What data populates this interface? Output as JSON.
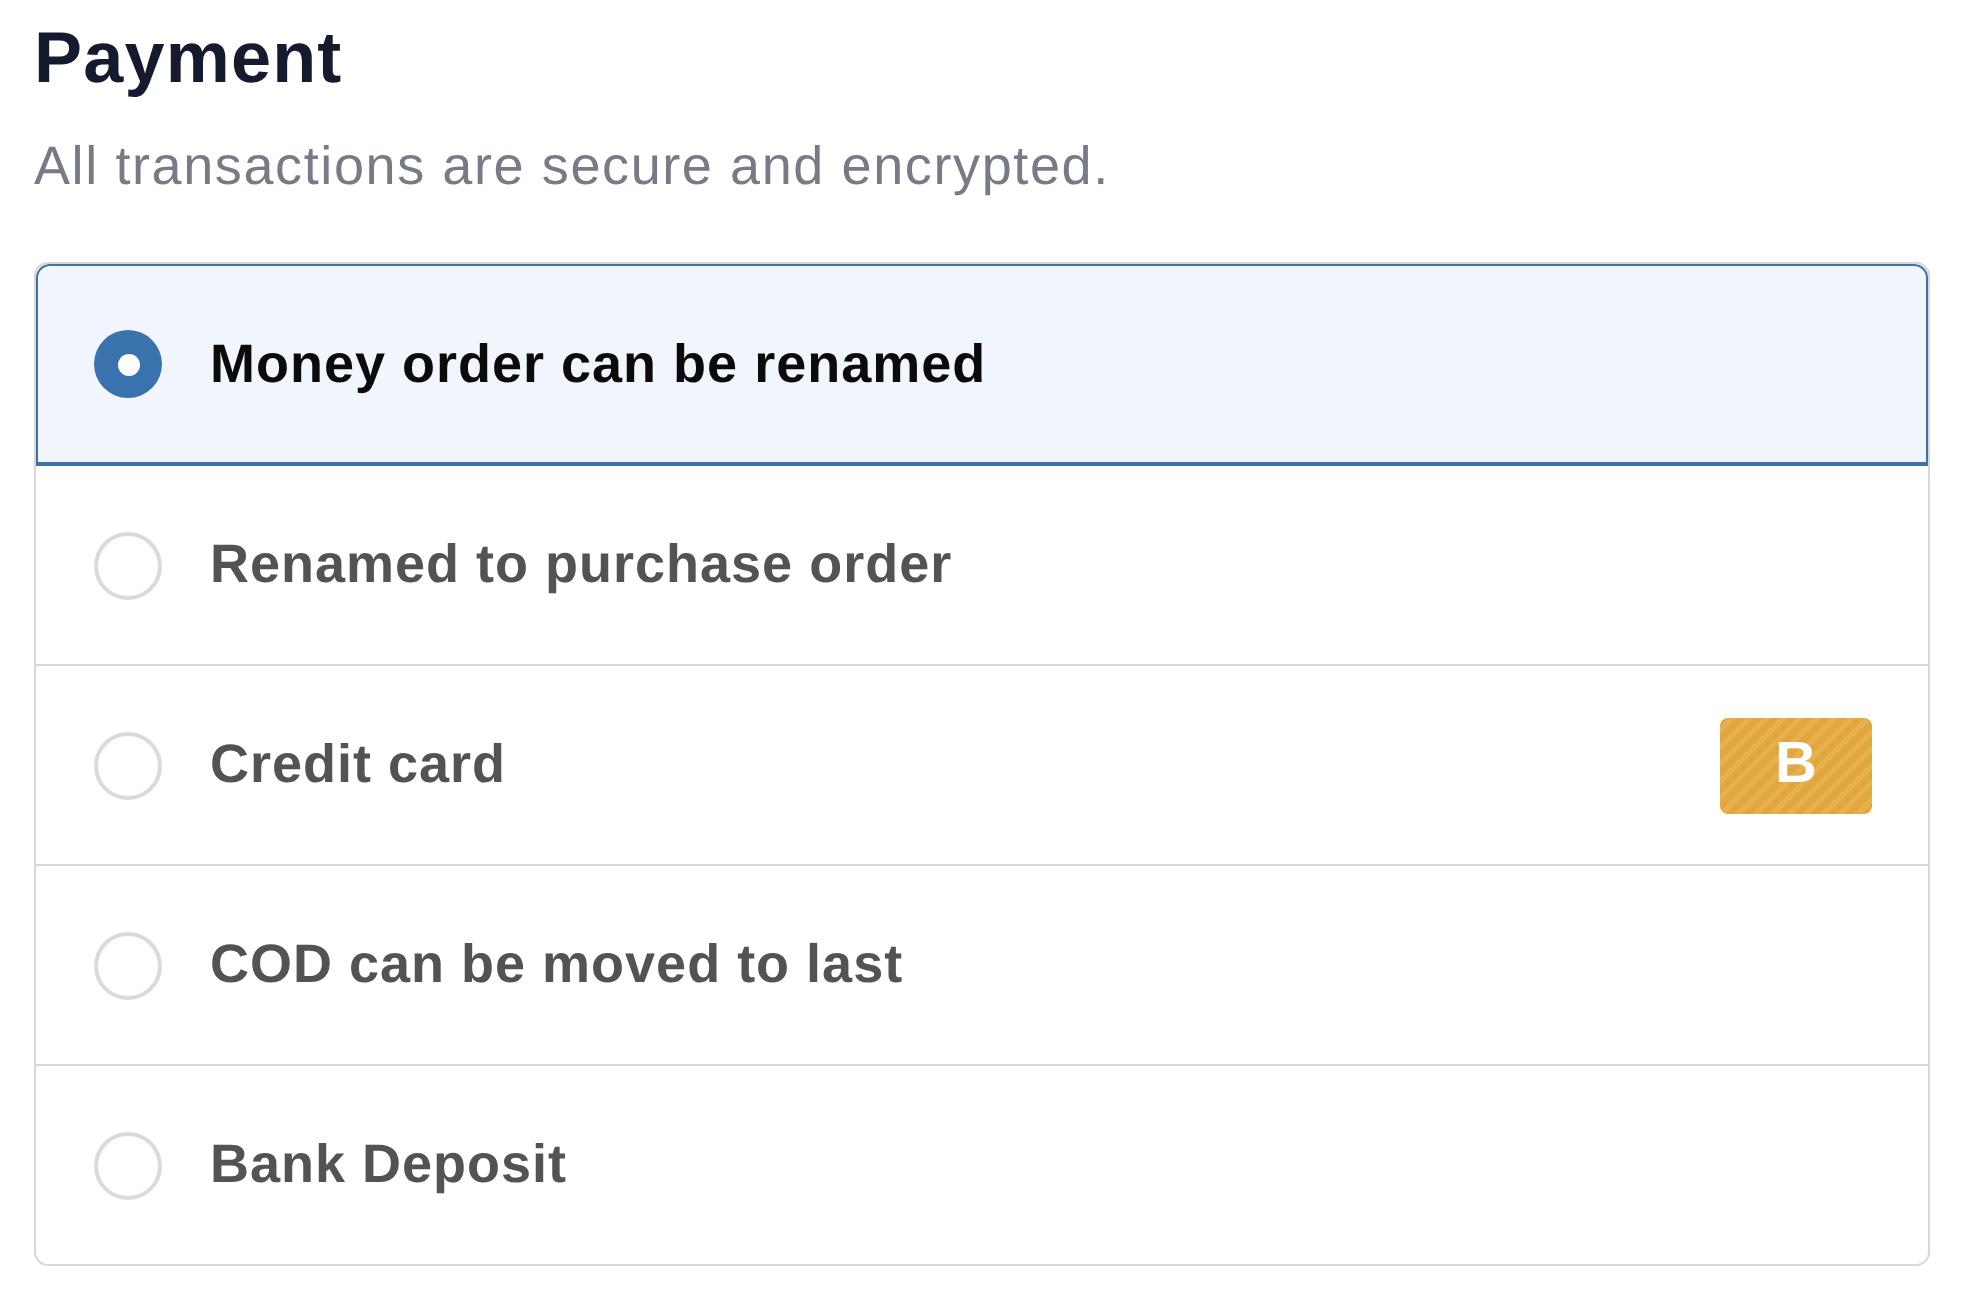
{
  "heading": {
    "title": "Payment",
    "subtitle": "All transactions are secure and encrypted."
  },
  "options": [
    {
      "label": "Money order can be renamed",
      "selected": true
    },
    {
      "label": "Renamed to purchase order",
      "selected": false
    },
    {
      "label": "Credit card",
      "selected": false,
      "badge": "B"
    },
    {
      "label": "COD can be moved to last",
      "selected": false
    },
    {
      "label": "Bank Deposit",
      "selected": false
    }
  ]
}
